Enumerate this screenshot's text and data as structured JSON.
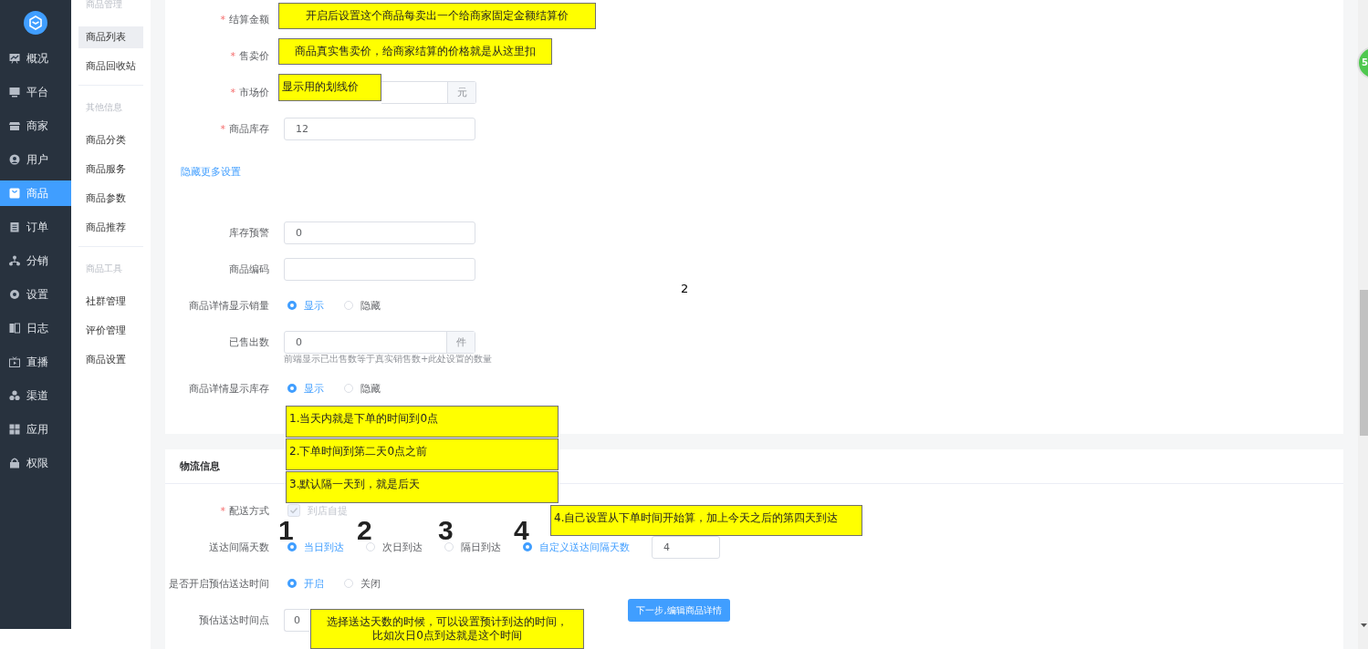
{
  "sidebar": {
    "items": [
      {
        "label": "概况",
        "selected": false
      },
      {
        "label": "平台",
        "selected": false
      },
      {
        "label": "商家",
        "selected": false
      },
      {
        "label": "用户",
        "selected": false
      },
      {
        "label": "商品",
        "selected": true
      },
      {
        "label": "订单",
        "selected": false
      },
      {
        "label": "分销",
        "selected": false
      },
      {
        "label": "设置",
        "selected": false
      },
      {
        "label": "日志",
        "selected": false
      },
      {
        "label": "直播",
        "selected": false
      },
      {
        "label": "渠道",
        "selected": false
      },
      {
        "label": "应用",
        "selected": false
      },
      {
        "label": "权限",
        "selected": false
      }
    ]
  },
  "submenu": {
    "groups": [
      {
        "title": "商品管理",
        "items": [
          {
            "label": "商品列表",
            "selected": true
          },
          {
            "label": "商品回收站",
            "selected": false
          }
        ]
      },
      {
        "title": "其他信息",
        "items": [
          {
            "label": "商品分类",
            "selected": false
          },
          {
            "label": "商品服务",
            "selected": false
          },
          {
            "label": "商品参数",
            "selected": false
          },
          {
            "label": "商品推荐",
            "selected": false
          }
        ]
      },
      {
        "title": "商品工具",
        "items": [
          {
            "label": "社群管理",
            "selected": false
          },
          {
            "label": "评价管理",
            "selected": false
          },
          {
            "label": "商品设置",
            "selected": false
          }
        ]
      }
    ]
  },
  "product_form": {
    "rows": [
      {
        "kind": "label_only",
        "required_mark": "*",
        "label": "结算金额"
      },
      {
        "kind": "label_only",
        "required_mark": "*",
        "label": "售卖价"
      },
      {
        "kind": "addon_tail",
        "required_mark": "*",
        "label": "市场价",
        "addon": "元"
      },
      {
        "kind": "input",
        "required_mark": "*",
        "label": "商品库存",
        "value": "12"
      }
    ],
    "more_link": "隐藏更多设置",
    "more_rows": [
      {
        "kind": "input",
        "label": "库存预警",
        "value": "0"
      },
      {
        "kind": "input",
        "label": "商品编码"
      },
      {
        "kind": "radio",
        "label": "商品详情显示销量",
        "options": [
          {
            "label": "显示",
            "selected": true
          },
          {
            "label": "隐藏",
            "selected": false
          }
        ]
      },
      {
        "kind": "addon",
        "label": "已售出数",
        "value": "0",
        "addon": "件",
        "hint": "前端显示已出售数等于真实销售数+此处设置的数量"
      },
      {
        "kind": "radio",
        "label": "商品详情显示库存",
        "options": [
          {
            "label": "显示",
            "selected": true
          },
          {
            "label": "隐藏",
            "selected": false
          }
        ]
      }
    ]
  },
  "logistics": {
    "title": "物流信息",
    "rows": [
      {
        "kind": "checkbox",
        "required_mark": "*",
        "label": "配送方式",
        "options": [
          {
            "label": "到店自提",
            "checked": true,
            "disabled": true
          }
        ]
      },
      {
        "kind": "radio",
        "label": "送达间隔天数",
        "options": [
          {
            "label": "当日到达",
            "selected": true
          },
          {
            "label": "次日到达",
            "selected": false
          },
          {
            "label": "隔日到达",
            "selected": false
          },
          {
            "label": "自定义送达间隔天数",
            "selected": true
          }
        ],
        "value": "4"
      },
      {
        "kind": "radio",
        "label": "是否开启预估送达时间",
        "options": [
          {
            "label": "开启",
            "selected": true
          },
          {
            "label": "关闭",
            "selected": false
          }
        ]
      },
      {
        "kind": "input_stub",
        "label": "预估送达时间点",
        "value": "0"
      }
    ]
  },
  "next_button": "下一步,编辑商品详情",
  "page_marker": "2",
  "badge": "5",
  "step_numbers": [
    "1",
    "2",
    "3",
    "4"
  ],
  "annotations": [
    {
      "lines": [
        "开启后设置这个商品每卖出一个给商家固定金额结算价"
      ]
    },
    {
      "lines": [
        "商品真实售卖价，给商家结算的价格就是从这里扣"
      ]
    },
    {
      "lines": [
        "显示用的划线价"
      ]
    },
    {
      "lines": [
        "1.当天内就是下单的时间到0点"
      ]
    },
    {
      "lines": [
        "2.下单时间到第二天0点之前"
      ]
    },
    {
      "lines": [
        "3.默认隔一天到，就是后天"
      ]
    },
    {
      "lines": [
        "4.自己设置从下单时间开始算，加上今天之后的第四天到达"
      ]
    },
    {
      "lines": [
        "选择送达天数的时候，可以设置预计到达的时间，",
        "比如次日0点到达就是这个时间"
      ]
    }
  ]
}
